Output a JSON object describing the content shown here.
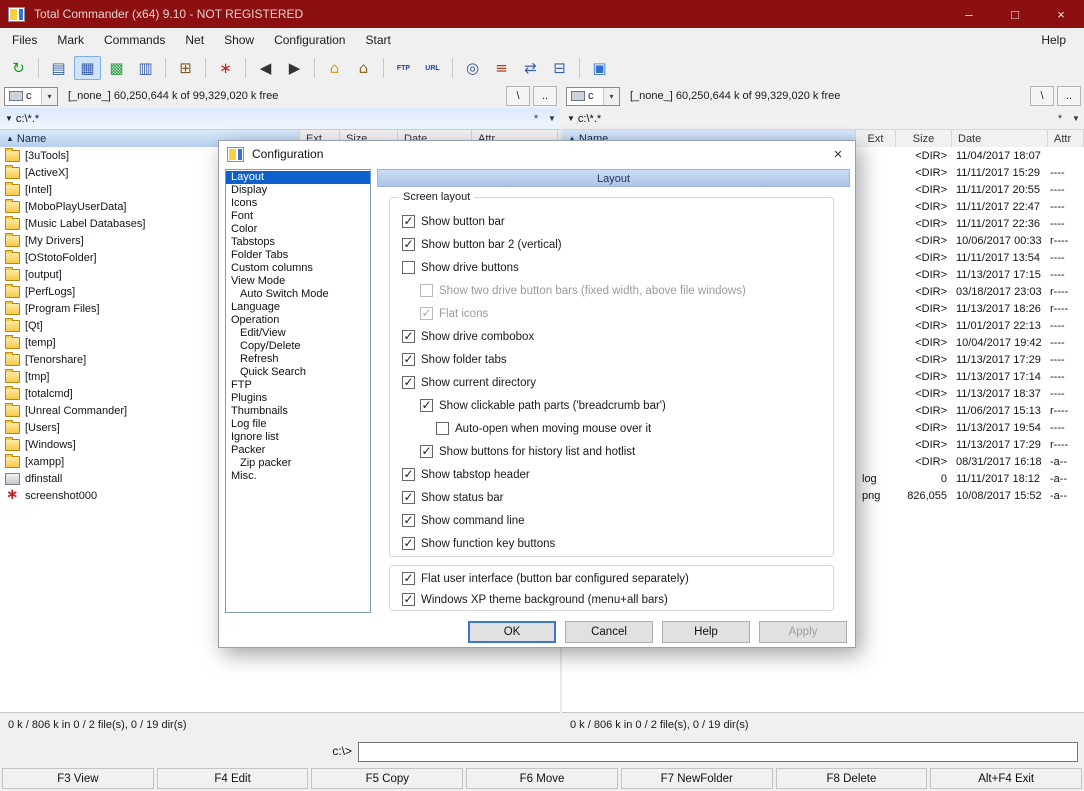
{
  "window": {
    "title": "Total Commander (x64) 9.10 - NOT REGISTERED",
    "titlebar_color": "#8c1010",
    "controls": {
      "minimize": "–",
      "maximize": "□",
      "close": "×"
    }
  },
  "menubar": {
    "items": [
      "Files",
      "Mark",
      "Commands",
      "Net",
      "Show",
      "Configuration",
      "Start"
    ],
    "help": "Help"
  },
  "toolbar": {
    "groups": [
      [
        {
          "name": "refresh-icon",
          "glyph": "↻",
          "color": "#18a018"
        }
      ],
      [
        {
          "name": "brief-view-icon",
          "glyph": "▤",
          "color": "#3a5fae"
        },
        {
          "name": "full-view-icon",
          "glyph": "▦",
          "color": "#3a5fae",
          "pressed": true
        },
        {
          "name": "thumbnails-view-icon",
          "glyph": "▩",
          "color": "#2e9e46"
        },
        {
          "name": "quick-view-icon",
          "glyph": "▥",
          "color": "#3a5fae"
        }
      ],
      [
        {
          "name": "tree-view-icon",
          "glyph": "⊞",
          "color": "#7a5a2a"
        }
      ],
      [
        {
          "name": "custom-columns-icon",
          "glyph": "∗",
          "color": "#c81e1e"
        }
      ],
      [
        {
          "name": "back-icon",
          "glyph": "◀",
          "color": "#333333"
        },
        {
          "name": "forward-icon",
          "glyph": "▶",
          "color": "#333333"
        }
      ],
      [
        {
          "name": "ftp-connect-icon",
          "glyph": "⌂",
          "color": "#c9a227"
        },
        {
          "name": "ftp-disconnect-icon",
          "glyph": "⌂",
          "color": "#8a6d1f"
        }
      ],
      [
        {
          "name": "ftp-show-icon",
          "glyph": "FTP",
          "color": "#1b3fa8",
          "text": true
        },
        {
          "name": "url-icon",
          "glyph": "URL",
          "color": "#1b3fa8",
          "text": true
        }
      ],
      [
        {
          "name": "find-files-icon",
          "glyph": "◎",
          "color": "#2f4f7f"
        },
        {
          "name": "compare-icon",
          "glyph": "≡",
          "color": "#b04020"
        },
        {
          "name": "sync-dirs-icon",
          "glyph": "⇄",
          "color": "#3a5fae"
        },
        {
          "name": "network-icon",
          "glyph": "⊟",
          "color": "#3a5fae"
        }
      ],
      [
        {
          "name": "calculator-icon",
          "glyph": "▣",
          "color": "#2f6fd0"
        }
      ]
    ]
  },
  "panels": {
    "sort_arrow": "▲",
    "common": {
      "root": "\\",
      "up": "..",
      "star": "*",
      "history": "▼",
      "combo_arrow": "▾"
    },
    "left": {
      "drive": "c",
      "free_text": "[_none_]  60,250,644 k of 99,329,020 k free",
      "path": "c:\\*.*",
      "columns": [
        "Name",
        "Ext",
        "Size",
        "Date",
        "Attr"
      ],
      "status": "0 k / 806 k in 0 / 2 file(s), 0 / 19 dir(s)",
      "files": [
        {
          "name": "[3uTools]",
          "icon": "folder"
        },
        {
          "name": "[ActiveX]",
          "icon": "folder"
        },
        {
          "name": "[Intel]",
          "icon": "folder"
        },
        {
          "name": "[MoboPlayUserData]",
          "icon": "folder"
        },
        {
          "name": "[Music Label Databases]",
          "icon": "folder"
        },
        {
          "name": "[My Drivers]",
          "icon": "folder"
        },
        {
          "name": "[OStotoFolder]",
          "icon": "folder"
        },
        {
          "name": "[output]",
          "icon": "folder"
        },
        {
          "name": "[PerfLogs]",
          "icon": "folder"
        },
        {
          "name": "[Program Files]",
          "icon": "folder"
        },
        {
          "name": "[Qt]",
          "icon": "folder"
        },
        {
          "name": "[temp]",
          "icon": "folder"
        },
        {
          "name": "[Tenorshare]",
          "icon": "folder"
        },
        {
          "name": "[tmp]",
          "icon": "folder"
        },
        {
          "name": "[totalcmd]",
          "icon": "folder"
        },
        {
          "name": "[Unreal Commander]",
          "icon": "folder"
        },
        {
          "name": "[Users]",
          "icon": "folder"
        },
        {
          "name": "[Windows]",
          "icon": "folder"
        },
        {
          "name": "[xampp]",
          "icon": "folder"
        },
        {
          "name": "dfinstall",
          "icon": "file"
        },
        {
          "name": "screenshot000",
          "icon": "image"
        }
      ]
    },
    "right": {
      "drive": "c",
      "free_text": "[_none_]  60,250,644 k of 99,329,020 k free",
      "path": "c:\\*.*",
      "columns": [
        "Name",
        "Ext",
        "Size",
        "Date",
        "Attr"
      ],
      "status": "0 k / 806 k in 0 / 2 file(s), 0 / 19 dir(s)",
      "rows": [
        {
          "ext": "",
          "size": "<DIR>",
          "date": "11/04/2017 18:07",
          "attr": ""
        },
        {
          "ext": "",
          "size": "<DIR>",
          "date": "11/11/2017 15:29",
          "attr": "----"
        },
        {
          "ext": "",
          "size": "<DIR>",
          "date": "11/11/2017 20:55",
          "attr": "----"
        },
        {
          "ext": "",
          "size": "<DIR>",
          "date": "11/11/2017 22:47",
          "attr": "----"
        },
        {
          "ext": "",
          "size": "<DIR>",
          "date": "11/11/2017 22:36",
          "attr": "----"
        },
        {
          "ext": "",
          "size": "<DIR>",
          "date": "10/06/2017 00:33",
          "attr": "r----"
        },
        {
          "ext": "",
          "size": "<DIR>",
          "date": "11/11/2017 13:54",
          "attr": "----"
        },
        {
          "ext": "",
          "size": "<DIR>",
          "date": "11/13/2017 17:15",
          "attr": "----"
        },
        {
          "ext": "",
          "size": "<DIR>",
          "date": "03/18/2017 23:03",
          "attr": "r----"
        },
        {
          "ext": "",
          "size": "<DIR>",
          "date": "11/13/2017 18:26",
          "attr": "r----"
        },
        {
          "ext": "",
          "size": "<DIR>",
          "date": "11/01/2017 22:13",
          "attr": "----"
        },
        {
          "ext": "",
          "size": "<DIR>",
          "date": "10/04/2017 19:42",
          "attr": "----"
        },
        {
          "ext": "",
          "size": "<DIR>",
          "date": "11/13/2017 17:29",
          "attr": "----"
        },
        {
          "ext": "",
          "size": "<DIR>",
          "date": "11/13/2017 17:14",
          "attr": "----"
        },
        {
          "ext": "",
          "size": "<DIR>",
          "date": "11/13/2017 18:37",
          "attr": "----"
        },
        {
          "ext": "",
          "size": "<DIR>",
          "date": "11/06/2017 15:13",
          "attr": "r----"
        },
        {
          "ext": "",
          "size": "<DIR>",
          "date": "11/13/2017 19:54",
          "attr": "----"
        },
        {
          "ext": "",
          "size": "<DIR>",
          "date": "11/13/2017 17:29",
          "attr": "r----"
        },
        {
          "ext": "",
          "size": "<DIR>",
          "date": "08/31/2017 16:18",
          "attr": "-a--"
        },
        {
          "ext": "log",
          "size": "0",
          "date": "11/11/2017 18:12",
          "attr": "-a--"
        },
        {
          "ext": "png",
          "size": "826,055",
          "date": "10/08/2017 15:52",
          "attr": "-a--"
        }
      ]
    }
  },
  "command_line": {
    "prompt": "c:\\>",
    "value": ""
  },
  "function_keys": [
    "F3 View",
    "F4 Edit",
    "F5 Copy",
    "F6 Move",
    "F7 NewFolder",
    "F8 Delete",
    "Alt+F4 Exit"
  ],
  "dialog": {
    "title": "Configuration",
    "page_header": "Layout",
    "check_glyph": "✓",
    "categories": [
      {
        "label": "Layout",
        "indent": 0,
        "selected": true
      },
      {
        "label": "Display",
        "indent": 0
      },
      {
        "label": "Icons",
        "indent": 0
      },
      {
        "label": "Font",
        "indent": 0
      },
      {
        "label": "Color",
        "indent": 0
      },
      {
        "label": "Tabstops",
        "indent": 0
      },
      {
        "label": "Folder Tabs",
        "indent": 0
      },
      {
        "label": "Custom columns",
        "indent": 0
      },
      {
        "label": "View Mode",
        "indent": 0
      },
      {
        "label": "Auto Switch Mode",
        "indent": 1
      },
      {
        "label": "Language",
        "indent": 0
      },
      {
        "label": "Operation",
        "indent": 0
      },
      {
        "label": "Edit/View",
        "indent": 1
      },
      {
        "label": "Copy/Delete",
        "indent": 1
      },
      {
        "label": "Refresh",
        "indent": 1
      },
      {
        "label": "Quick Search",
        "indent": 1
      },
      {
        "label": "FTP",
        "indent": 0
      },
      {
        "label": "Plugins",
        "indent": 0
      },
      {
        "label": "Thumbnails",
        "indent": 0
      },
      {
        "label": "Log file",
        "indent": 0
      },
      {
        "label": "Ignore list",
        "indent": 0
      },
      {
        "label": "Packer",
        "indent": 0
      },
      {
        "label": "Zip packer",
        "indent": 1
      },
      {
        "label": "Misc.",
        "indent": 0
      }
    ],
    "group1": {
      "label": "Screen layout",
      "checkboxes": [
        {
          "label": "Show button bar",
          "checked": true,
          "indent": 0
        },
        {
          "label": "Show button bar 2 (vertical)",
          "checked": true,
          "indent": 0
        },
        {
          "label": "Show drive buttons",
          "checked": false,
          "indent": 0
        },
        {
          "label": "Show two drive button bars (fixed width, above file windows)",
          "checked": false,
          "indent": 1,
          "disabled": true
        },
        {
          "label": "Flat icons",
          "checked": true,
          "indent": 1,
          "disabled": true
        },
        {
          "label": "Show drive combobox",
          "checked": true,
          "indent": 0
        },
        {
          "label": "Show folder tabs",
          "checked": true,
          "indent": 0
        },
        {
          "label": "Show current directory",
          "checked": true,
          "indent": 0
        },
        {
          "label": "Show clickable path parts ('breadcrumb bar')",
          "checked": true,
          "indent": 1
        },
        {
          "label": "Auto-open when moving mouse over it",
          "checked": false,
          "indent": 2
        },
        {
          "label": "Show buttons for history list and hotlist",
          "checked": true,
          "indent": 1
        },
        {
          "label": "Show tabstop header",
          "checked": true,
          "indent": 0
        },
        {
          "label": "Show status bar",
          "checked": true,
          "indent": 0
        },
        {
          "label": "Show command line",
          "checked": true,
          "indent": 0
        },
        {
          "label": "Show function key buttons",
          "checked": true,
          "indent": 0
        }
      ]
    },
    "group2": {
      "checkboxes": [
        {
          "label": "Flat user interface (button bar configured separately)",
          "checked": true,
          "indent": 0
        },
        {
          "label": "Windows XP theme background (menu+all bars)",
          "checked": true,
          "indent": 0
        }
      ]
    },
    "buttons": [
      {
        "label": "OK",
        "default": true
      },
      {
        "label": "Cancel"
      },
      {
        "label": "Help"
      },
      {
        "label": "Apply",
        "disabled": true
      }
    ]
  }
}
